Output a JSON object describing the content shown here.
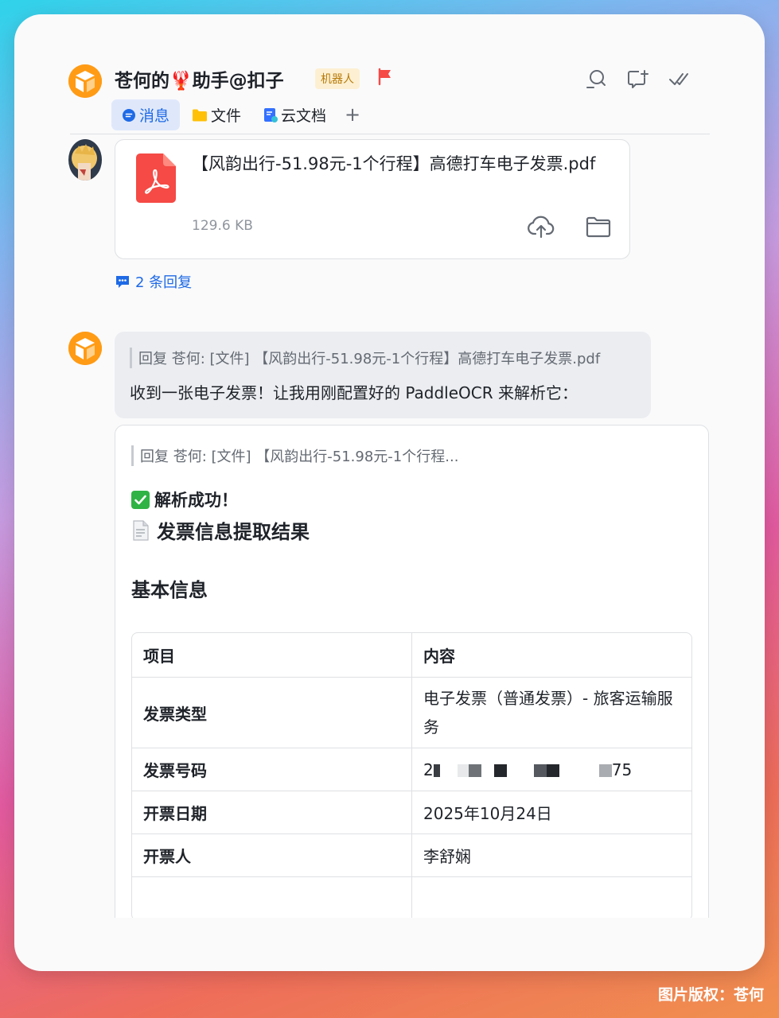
{
  "header": {
    "title": "苍何的🦞助手@扣子",
    "badge": "机器人"
  },
  "tabs": [
    {
      "label": "消息",
      "active": true
    },
    {
      "label": "文件",
      "active": false
    },
    {
      "label": "云文档",
      "active": false
    }
  ],
  "file_message": {
    "file_name": "【风韵出行-51.98元-1个行程】高德打车电子发票.pdf",
    "file_size": "129.6 KB",
    "replies": "2 条回复"
  },
  "bot_reply": {
    "quote": "回复 苍何: [文件] 【风韵出行-51.98元-1个行程】高德打车电子发票.pdf",
    "text": "收到一张电子发票！让我用刚配置好的 PaddleOCR 来解析它："
  },
  "result_card": {
    "quote": "回复 苍何: [文件] 【风韵出行-51.98元-1个行程...",
    "success": "解析成功！",
    "heading": "发票信息提取结果",
    "section": "基本信息",
    "table": {
      "headers": [
        "项目",
        "内容"
      ],
      "rows": [
        {
          "key": "发票类型",
          "value": "电子发票（普通发票）- 旅客运输服务"
        },
        {
          "key": "发票号码",
          "value_start": "2",
          "value_end": "75"
        },
        {
          "key": "开票日期",
          "value": "2025年10月24日"
        },
        {
          "key": "开票人",
          "value": "李舒娴"
        },
        {
          "key": "",
          "value": ""
        }
      ]
    }
  },
  "watermark": "图片版权：苍何",
  "colors": {
    "accent": "#1e6ae6",
    "bot_orange": "#ff9b15",
    "pdf_red": "#f54a45"
  }
}
